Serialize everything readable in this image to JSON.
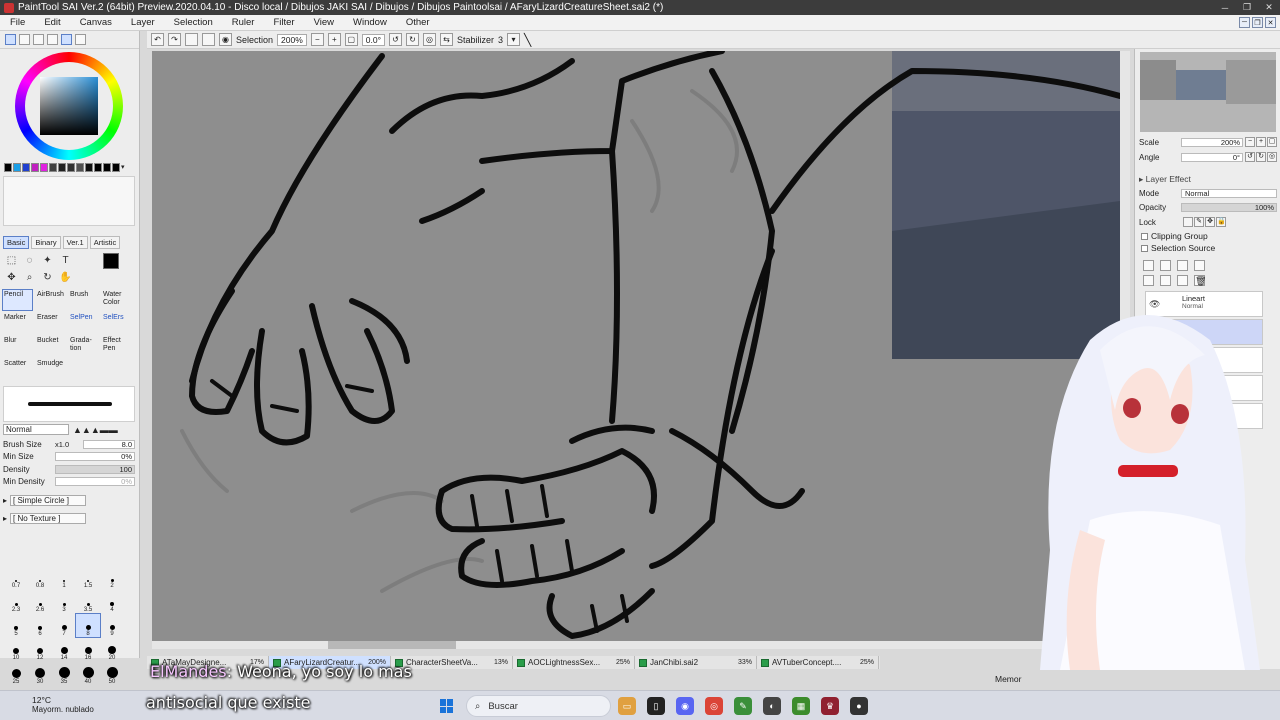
{
  "window": {
    "title": "PaintTool SAI Ver.2 (64bit) Preview.2020.04.10 - Disco local / Dibujos JAKI SAI / Dibujos / Dibujos Paintoolsai / AFaryLizardCreatureSheet.sai2 (*)"
  },
  "menu": [
    "File",
    "Edit",
    "Canvas",
    "Layer",
    "Selection",
    "Ruler",
    "Filter",
    "View",
    "Window",
    "Other"
  ],
  "canvas_toolbar": {
    "selection_label": "Selection",
    "zoom": "200%",
    "angle": "0.0°",
    "stabilizer_label": "Stabilizer",
    "stabilizer_value": "3"
  },
  "color_panel": {
    "current_color": "#000000",
    "palette": [
      "#000000",
      "#1aa0e8",
      "#2040d0",
      "#c020c0",
      "#e020e0",
      "#404040",
      "#202020",
      "#303030",
      "#505050",
      "#101010",
      "#000000",
      "#000000",
      "#000000"
    ]
  },
  "tool_modes": [
    "Basic",
    "Binary",
    "Ver.1",
    "Artistic"
  ],
  "brushes": [
    {
      "label": "Pencil",
      "sel": true
    },
    {
      "label": "AirBrush",
      "sel": false
    },
    {
      "label": "Brush",
      "sel": false
    },
    {
      "label": "Water Color",
      "sel": false
    },
    {
      "label": "Marker",
      "sel": false
    },
    {
      "label": "Eraser",
      "sel": false
    },
    {
      "label": "SelPen",
      "sel": false,
      "blue": true
    },
    {
      "label": "SelErs",
      "sel": false,
      "blue": true
    },
    {
      "label": "Blur",
      "sel": false
    },
    {
      "label": "Bucket",
      "sel": false
    },
    {
      "label": "Grada-tion",
      "sel": false
    },
    {
      "label": "Effect Pen",
      "sel": false
    },
    {
      "label": "Scatter",
      "sel": false
    },
    {
      "label": "Smudge",
      "sel": false
    }
  ],
  "brush_settings": {
    "blend_mode": "Normal",
    "brush_size_label": "Brush Size",
    "brush_size_multiplier": "x1.0",
    "brush_size_value": "8.0",
    "min_size_label": "Min Size",
    "min_size_value": "0%",
    "density_label": "Density",
    "density_value": "100",
    "min_density_label": "Min Density",
    "min_density_value": "0%",
    "shape": "[ Simple Circle ]",
    "texture": "[ No Texture ]"
  },
  "brush_sizes": [
    "0.7",
    "0.8",
    "1",
    "1.5",
    "2",
    "2.3",
    "2.6",
    "3",
    "3.5",
    "4",
    "5",
    "6",
    "7",
    "8",
    "9",
    "10",
    "12",
    "14",
    "16",
    "20",
    "25",
    "30",
    "35",
    "40",
    "50"
  ],
  "selected_brush_size": "8",
  "right_panel": {
    "scale_label": "Scale",
    "scale_value": "200%",
    "angle_label": "Angle",
    "angle_value": "0°",
    "layer_effect_label": "Layer Effect",
    "mode_label": "Mode",
    "mode_value": "Normal",
    "opacity_label": "Opacity",
    "opacity_value": "100%",
    "lock_label": "Lock",
    "clipping_group_label": "Clipping Group",
    "selection_source_label": "Selection Source",
    "layers": [
      {
        "name": "Lineart",
        "mode": "Normal",
        "selected": false
      },
      {
        "name": "",
        "mode": "",
        "selected": true
      },
      {
        "name": "",
        "mode": "",
        "selected": false
      },
      {
        "name": "",
        "mode": "",
        "selected": false
      },
      {
        "name": "",
        "mode": "",
        "selected": false
      }
    ]
  },
  "doc_tabs": [
    {
      "name": "ATaMayDesigne...",
      "pct": "17%",
      "active": false
    },
    {
      "name": "AFaryLizardCreatur...",
      "pct": "200%",
      "active": true
    },
    {
      "name": "CharacterSheetVa...",
      "pct": "13%",
      "active": false
    },
    {
      "name": "AOCLightnessSex...",
      "pct": "25%",
      "active": false
    },
    {
      "name": "JanChibi.sai2",
      "pct": "33%",
      "active": false
    },
    {
      "name": "AVTuberConcept....",
      "pct": "25%",
      "active": false
    }
  ],
  "memory_label": "Memor",
  "subtitles": {
    "speaker": "ElMandes",
    "line1": ": Weona, yo soy lo mas",
    "line2": "antisocial que existe"
  },
  "taskbar": {
    "temperature": "12°C",
    "condition": "Mayorm. nublado",
    "search_placeholder": "Buscar"
  }
}
